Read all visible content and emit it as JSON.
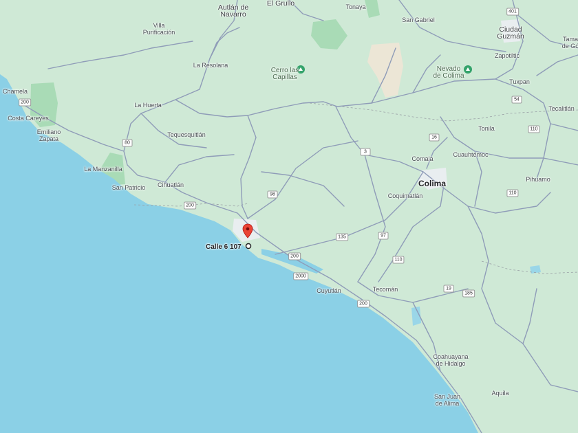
{
  "map": {
    "colors": {
      "ocean": "#8bd0e6",
      "land": "#cfe9d6",
      "road": "#8f9cb8",
      "urban": "#e9eef0",
      "pin": "#ea4335"
    },
    "pin": {
      "label": "Calle 6 107",
      "icon": "location-pin-icon"
    },
    "places": [
      {
        "name": "Autlán de\nNavarro",
        "size": "city"
      },
      {
        "name": "El Grullo",
        "size": "city"
      },
      {
        "name": "Tonaya",
        "size": "town"
      },
      {
        "name": "San Gabriel",
        "size": "town"
      },
      {
        "name": "Villa\nPurificación",
        "size": "town"
      },
      {
        "name": "Ciudad\nGuzmán",
        "size": "city"
      },
      {
        "name": "Tama\nde Gó",
        "size": "town"
      },
      {
        "name": "Zapotiltic",
        "size": "town"
      },
      {
        "name": "La Resolana",
        "size": "town"
      },
      {
        "name": "Tuxpan",
        "size": "town"
      },
      {
        "name": "Chamela",
        "size": "town"
      },
      {
        "name": "La Huerta",
        "size": "town"
      },
      {
        "name": "Tecalitlán",
        "size": "town"
      },
      {
        "name": "Costa Careyes",
        "size": "town"
      },
      {
        "name": "Emiliano\nZapata",
        "size": "town"
      },
      {
        "name": "Tequesquitlán",
        "size": "town"
      },
      {
        "name": "Tonila",
        "size": "town"
      },
      {
        "name": "Cuauhtémoc",
        "size": "town"
      },
      {
        "name": "Comala",
        "size": "town"
      },
      {
        "name": "La Manzanilla",
        "size": "town"
      },
      {
        "name": "Colima",
        "size": "big"
      },
      {
        "name": "Pihuamo",
        "size": "town"
      },
      {
        "name": "San Patricio",
        "size": "town"
      },
      {
        "name": "Cihuatlán",
        "size": "town"
      },
      {
        "name": "Coquimatlán",
        "size": "town"
      },
      {
        "name": "Cuyutlán",
        "size": "town"
      },
      {
        "name": "Tecomán",
        "size": "town"
      },
      {
        "name": "Coahuayana\nde Hidalgo",
        "size": "town"
      },
      {
        "name": "San Juan\nde Alima",
        "size": "town"
      },
      {
        "name": "Aquila",
        "size": "town"
      }
    ],
    "pois": [
      {
        "name": "Cerro las\nCapillas",
        "icon": "mountain-icon"
      },
      {
        "name": "Nevado\nde Colima",
        "icon": "mountain-icon"
      }
    ],
    "shields": [
      "401",
      "200",
      "54",
      "110",
      "16",
      "80",
      "3",
      "98",
      "200",
      "135",
      "97",
      "200",
      "110",
      "110",
      "19",
      "185",
      "2000",
      "200"
    ]
  }
}
